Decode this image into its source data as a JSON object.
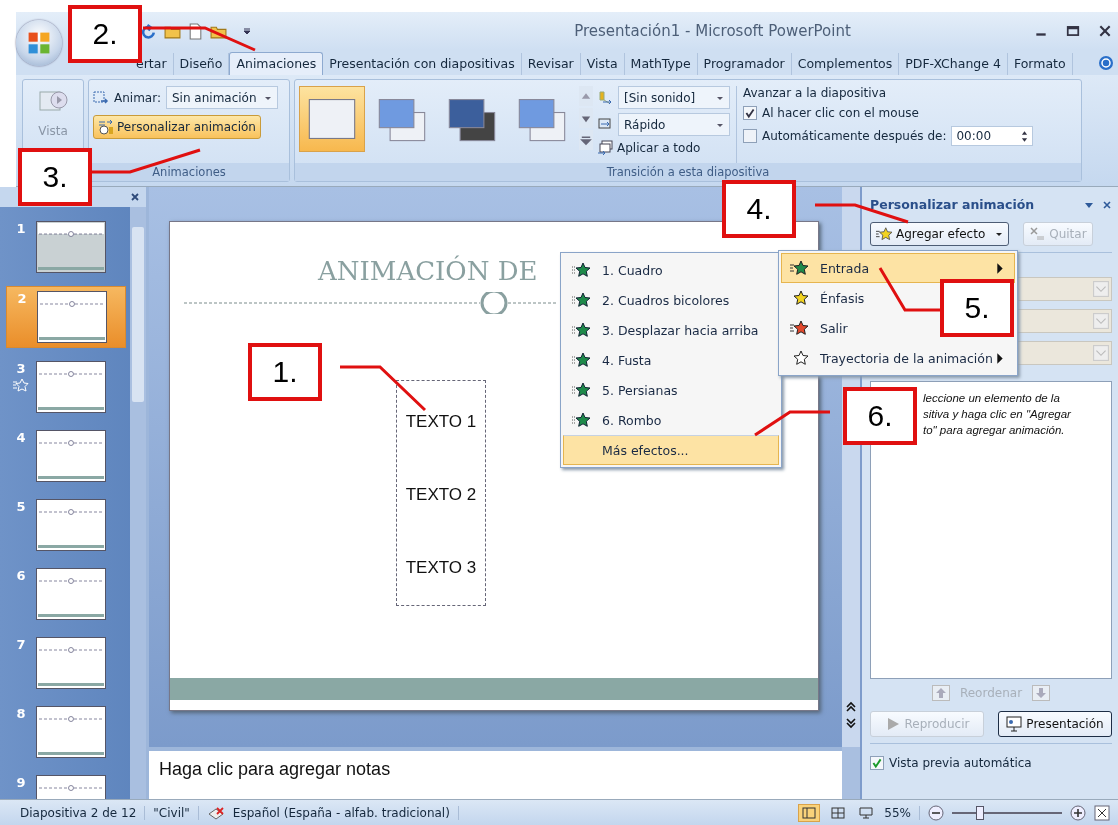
{
  "window": {
    "title": "Presentación1 - Microsoft PowerPoint"
  },
  "tabs": [
    {
      "label": "ertar",
      "selected": false
    },
    {
      "label": "Diseño",
      "selected": false
    },
    {
      "label": "Animaciones",
      "selected": true
    },
    {
      "label": "Presentación con diapositivas",
      "selected": false
    },
    {
      "label": "Revisar",
      "selected": false
    },
    {
      "label": "Vista",
      "selected": false
    },
    {
      "label": "MathType",
      "selected": false
    },
    {
      "label": "Programador",
      "selected": false
    },
    {
      "label": "Complementos",
      "selected": false
    },
    {
      "label": "PDF-XChange 4",
      "selected": false
    },
    {
      "label": "Formato",
      "selected": false
    }
  ],
  "ribbon": {
    "vista": {
      "label": "Vista",
      "disabled": true
    },
    "animations_group": {
      "label": "Animaciones",
      "animate_label": "Animar:",
      "animate_value": "Sin animación",
      "custom_button": {
        "label": "Personalizar animación",
        "selected": true
      }
    },
    "transition_group": {
      "label": "Transición a esta diapositiva",
      "thumbnails": [
        {
          "selected": true
        },
        {
          "selected": false
        },
        {
          "selected": false
        },
        {
          "selected": false
        }
      ],
      "sound": "[Sin sonido]",
      "speed": "Rápido",
      "apply_all": "Aplicar a todo"
    },
    "advance_group": {
      "label": "Avanzar a la diapositiva",
      "options": [
        {
          "label": "Al hacer clic con el mouse",
          "checked": true
        },
        {
          "label": "Automáticamente después de:",
          "checked": false
        }
      ],
      "time": "00:00"
    }
  },
  "slides_panel": {
    "slides": [
      {
        "number": "1",
        "selected": false,
        "animated": false
      },
      {
        "number": "2",
        "selected": true,
        "animated": false
      },
      {
        "number": "3",
        "selected": false,
        "animated": true
      },
      {
        "number": "4",
        "selected": false,
        "animated": false
      },
      {
        "number": "5",
        "selected": false,
        "animated": false
      },
      {
        "number": "6",
        "selected": false,
        "animated": false
      },
      {
        "number": "7",
        "selected": false,
        "animated": false
      },
      {
        "number": "8",
        "selected": false,
        "animated": false
      },
      {
        "number": "9",
        "selected": false,
        "animated": false
      }
    ]
  },
  "slide": {
    "title": "ANIMACIÓN DE",
    "text_boxes": [
      "TEXTO 1",
      "TEXTO 2",
      "TEXTO 3"
    ]
  },
  "notes": {
    "placeholder": "Haga clic para agregar notas"
  },
  "effect_menu": {
    "items": [
      {
        "label": "1. Cuadro",
        "selected": false,
        "kind": "effect"
      },
      {
        "label": "2. Cuadros bicolores",
        "selected": false,
        "kind": "effect"
      },
      {
        "label": "3. Desplazar hacia arriba",
        "selected": false,
        "kind": "effect"
      },
      {
        "label": "4. Fusta",
        "selected": false,
        "kind": "effect"
      },
      {
        "label": "5. Persianas",
        "selected": false,
        "kind": "effect"
      },
      {
        "label": "6. Rombo",
        "selected": false,
        "kind": "effect"
      },
      {
        "label": "Más efectos...",
        "selected": true,
        "kind": "more"
      }
    ]
  },
  "category_menu": {
    "items": [
      {
        "label": "Entrada",
        "selected": true,
        "submenu": true,
        "kind": "entrance"
      },
      {
        "label": "Énfasis",
        "selected": false,
        "submenu": false,
        "kind": "emphasis"
      },
      {
        "label": "Salir",
        "selected": false,
        "submenu": false,
        "kind": "exit"
      },
      {
        "label": "Trayectoria de la animación",
        "selected": false,
        "submenu": true,
        "kind": "path"
      }
    ]
  },
  "task_pane": {
    "title": "Personalizar animación",
    "add_button": {
      "label": "Agregar efecto"
    },
    "remove_button": {
      "label": "Quitar",
      "disabled": true
    },
    "help_text": "leccione un elemento de la\nsitiva y haga clic en \"Agregar\nto\" para agregar animación.",
    "reorder_label": "Reordenar",
    "play_button": {
      "label": "Reproducir",
      "disabled": true
    },
    "show_button": {
      "label": "Presentación"
    },
    "autopreview": {
      "label": "Vista previa automática",
      "checked": true
    }
  },
  "status_bar": {
    "slide_info": "Diapositiva 2 de 12",
    "theme": "\"Civil\"",
    "language": "Español (España - alfab. tradicional)",
    "views": [
      {
        "selected": true
      },
      {
        "selected": false
      },
      {
        "selected": false
      }
    ],
    "zoom": "55%",
    "zoom_slider": {
      "level": 0.25
    }
  },
  "callouts": [
    "1.",
    "2.",
    "3.",
    "4.",
    "5.",
    "6."
  ]
}
